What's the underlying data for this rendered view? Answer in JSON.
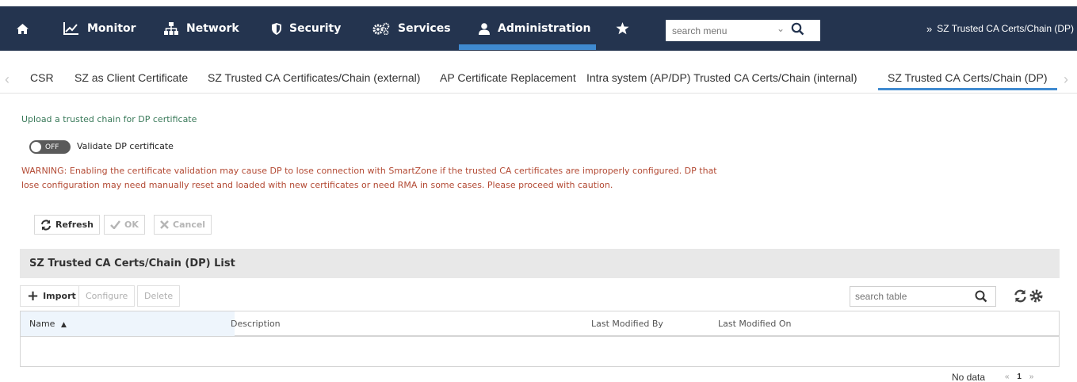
{
  "nav": {
    "items": [
      {
        "label": "Monitor"
      },
      {
        "label": "Network"
      },
      {
        "label": "Security"
      },
      {
        "label": "Services"
      },
      {
        "label": "Administration"
      }
    ],
    "search_placeholder": "search menu",
    "breadcrumb": "SZ Trusted CA Certs/Chain (DP)",
    "colors": {
      "bar": "#24344f",
      "active": "#3f8ad0"
    }
  },
  "tabs": [
    {
      "label": "CSR"
    },
    {
      "label": "SZ as Client Certificate"
    },
    {
      "label": "SZ Trusted CA Certificates/Chain (external)"
    },
    {
      "label": "AP Certificate Replacement"
    },
    {
      "label": "Intra system (AP/DP) Trusted CA Certs/Chain (internal)"
    },
    {
      "label": "SZ Trusted CA Certs/Chain (DP)",
      "active": true
    }
  ],
  "content": {
    "title": "Upload a trusted chain for DP certificate",
    "toggle_state": "OFF",
    "toggle_label": "Validate DP certificate",
    "warning_line1": "WARNING: Enabling the certificate validation may cause DP to lose connection with SmartZone if the trusted CA certificates are improperly configured. DP that",
    "warning_line2": "lose configuration may need manually reset and loaded with new certificates or need RMA in some cases. Please proceed with caution.",
    "buttons": {
      "refresh": "Refresh",
      "ok": "OK",
      "cancel": "Cancel"
    }
  },
  "list": {
    "title": "SZ Trusted CA Certs/Chain (DP) List",
    "toolbar": {
      "import": "Import",
      "configure": "Configure",
      "delete": "Delete"
    },
    "search_placeholder": "search table",
    "columns": [
      "Name",
      "Description",
      "Last Modified By",
      "Last Modified On"
    ],
    "rows": [],
    "footer": "No data",
    "page": "1"
  }
}
